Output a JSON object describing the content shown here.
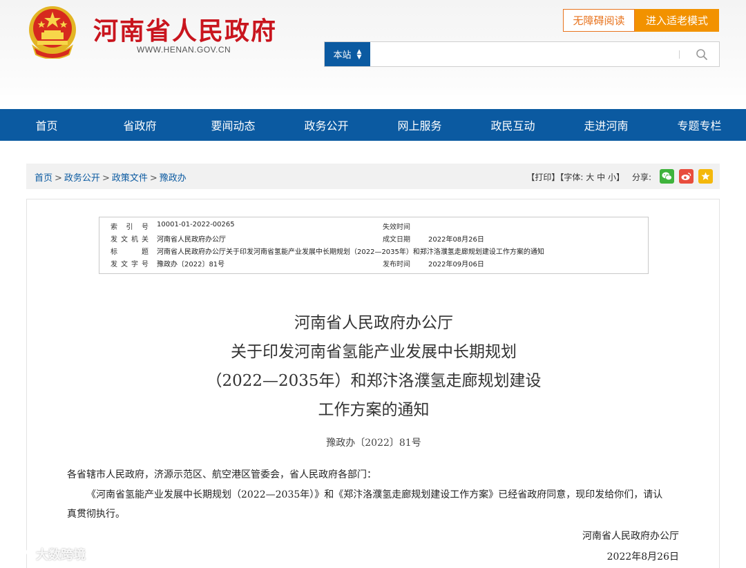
{
  "header": {
    "site_title": "河南省人民政府",
    "site_url": "WWW.HENAN.GOV.CN",
    "accessibility_btn": "无障碍阅读",
    "elder_mode_btn": "进入适老模式",
    "emblem_icon": "national-emblem-icon"
  },
  "search": {
    "scope": "本站",
    "placeholder": "",
    "icon": "search-icon"
  },
  "nav": {
    "items": [
      "首页",
      "省政府",
      "要闻动态",
      "政务公开",
      "网上服务",
      "政民互动",
      "走进河南",
      "专题专栏"
    ]
  },
  "breadcrumb": {
    "items": [
      "首页",
      "政务公开",
      "政策文件",
      "豫政办"
    ],
    "separator": ">"
  },
  "tools": {
    "print": "【打印】",
    "font_prefix": "【字体:",
    "font_large": "大",
    "font_medium": "中",
    "font_small": "小",
    "font_suffix": "】",
    "share_label": "分享:"
  },
  "meta": {
    "index_label": "索 引 号",
    "index_value": "10001-01-2022-00265",
    "expire_label": "失效时间",
    "expire_value": "",
    "issuer_label": "发文机关",
    "issuer_value": "河南省人民政府办公厅",
    "written_label": "成文日期",
    "written_value": "2022年08月26日",
    "title_label": "标　　题",
    "title_value": "河南省人民政府办公厅关于印发河南省氢能产业发展中长期规划（2022—2035年）和郑汴洛濮氢走廊规划建设工作方案的通知",
    "docno_label": "发文字号",
    "docno_value": "豫政办〔2022〕81号",
    "publish_label": "发布时间",
    "publish_value": "2022年09月06日"
  },
  "document": {
    "title_line1": "河南省人民政府办公厅",
    "title_line2": "关于印发河南省氢能产业发展中长期规划",
    "title_line3": "（2022—2035年）和郑汴洛濮氢走廊规划建设",
    "title_line4": "工作方案的通知",
    "doc_number": "豫政办〔2022〕81号",
    "salutation": "各省辖市人民政府，济源示范区、航空港区管委会，省人民政府各部门：",
    "paragraph": "《河南省氢能产业发展中长期规划（2022—2035年）》和《郑汴洛濮氢走廊规划建设工作方案》已经省政府同意，现印发给你们，请认真贯彻执行。",
    "signer": "河南省人民政府办公厅",
    "sign_date": "2022年8月26日"
  },
  "watermark": {
    "text": "大数跨境"
  },
  "colors": {
    "brand_red": "#c9151e",
    "nav_blue": "#0b5aa1",
    "accent_orange": "#f29200"
  }
}
